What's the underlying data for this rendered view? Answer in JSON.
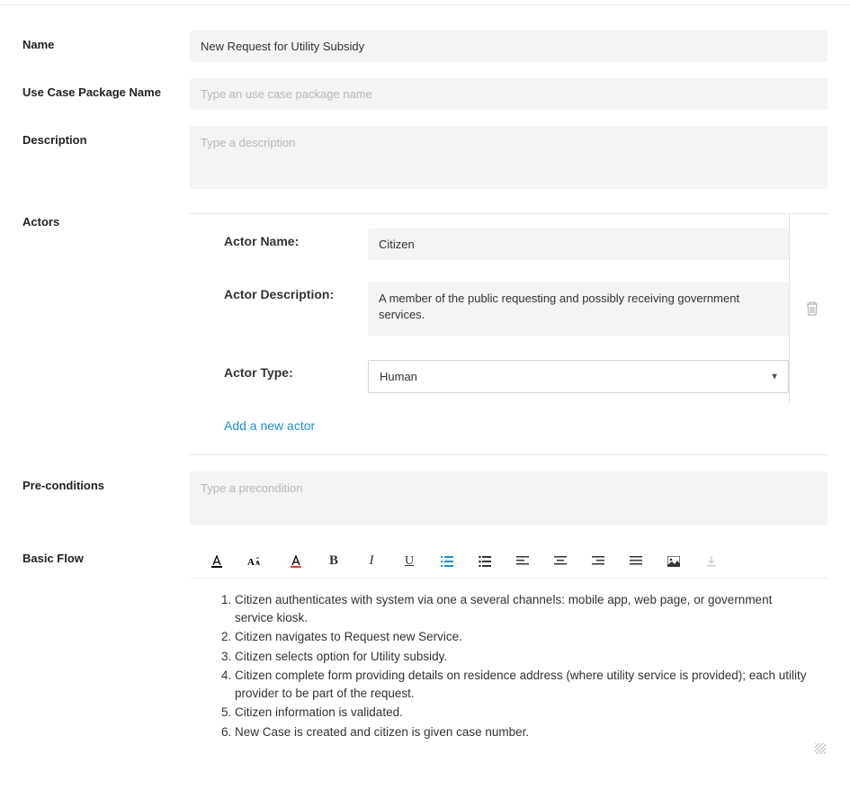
{
  "labels": {
    "name": "Name",
    "pkg": "Use Case Package Name",
    "desc": "Description",
    "actors": "Actors",
    "actor_name": "Actor Name:",
    "actor_desc": "Actor Description:",
    "actor_type": "Actor Type:",
    "add_actor": "Add a new actor",
    "precond": "Pre-conditions",
    "basic_flow": "Basic Flow"
  },
  "values": {
    "name": "New Request for Utility Subsidy",
    "actor_name": "Citizen",
    "actor_desc": "A member of the public requesting and possibly receiving government services.",
    "actor_type": "Human"
  },
  "placeholders": {
    "pkg": "Type an use case package name",
    "desc": "Type a description",
    "precond": "Type a precondition"
  },
  "basic_flow_steps": [
    "Citizen authenticates with system via one a several channels: mobile app, web page, or government service kiosk.",
    "Citizen navigates to Request new Service.",
    "Citizen selects option for Utility subsidy.",
    "Citizen complete form providing details on residence address (where utility service is provided); each utility provider to be part of the request.",
    "Citizen information is validated.",
    "New Case is created and citizen is given case number."
  ]
}
